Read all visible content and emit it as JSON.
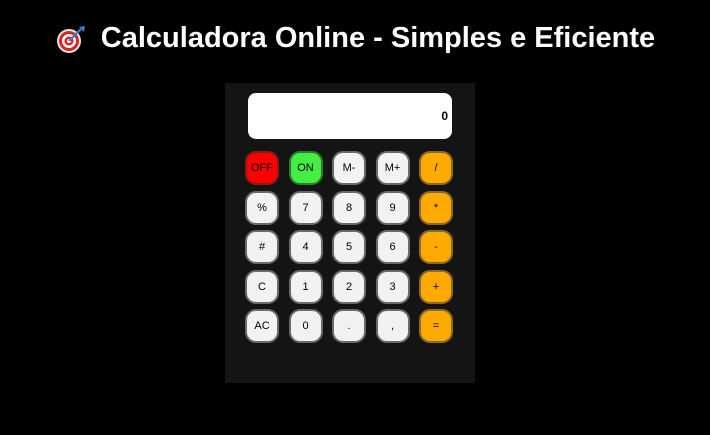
{
  "header": {
    "icon": "target-dart-icon",
    "title": "Calculadora Online - Simples e Eficiente"
  },
  "display": {
    "value": "0"
  },
  "keys": [
    {
      "label": "OFF",
      "name": "off-button",
      "kind": "off"
    },
    {
      "label": "ON",
      "name": "on-button",
      "kind": "on"
    },
    {
      "label": "M-",
      "name": "memory-minus-button",
      "kind": "num"
    },
    {
      "label": "M+",
      "name": "memory-plus-button",
      "kind": "num"
    },
    {
      "label": "/",
      "name": "divide-button",
      "kind": "op"
    },
    {
      "label": "%",
      "name": "percent-button",
      "kind": "num"
    },
    {
      "label": "7",
      "name": "digit-7-button",
      "kind": "num"
    },
    {
      "label": "8",
      "name": "digit-8-button",
      "kind": "num"
    },
    {
      "label": "9",
      "name": "digit-9-button",
      "kind": "num"
    },
    {
      "label": "*",
      "name": "multiply-button",
      "kind": "op"
    },
    {
      "label": "#",
      "name": "hash-button",
      "kind": "num"
    },
    {
      "label": "4",
      "name": "digit-4-button",
      "kind": "num"
    },
    {
      "label": "5",
      "name": "digit-5-button",
      "kind": "num"
    },
    {
      "label": "6",
      "name": "digit-6-button",
      "kind": "num"
    },
    {
      "label": "-",
      "name": "subtract-button",
      "kind": "op"
    },
    {
      "label": "C",
      "name": "clear-button",
      "kind": "num"
    },
    {
      "label": "1",
      "name": "digit-1-button",
      "kind": "num"
    },
    {
      "label": "2",
      "name": "digit-2-button",
      "kind": "num"
    },
    {
      "label": "3",
      "name": "digit-3-button",
      "kind": "num"
    },
    {
      "label": "+",
      "name": "add-button",
      "kind": "op"
    },
    {
      "label": "AC",
      "name": "all-clear-button",
      "kind": "num"
    },
    {
      "label": "0",
      "name": "digit-0-button",
      "kind": "num"
    },
    {
      "label": ".",
      "name": "decimal-point-button",
      "kind": "num"
    },
    {
      "label": ",",
      "name": "comma-button",
      "kind": "num"
    },
    {
      "label": "=",
      "name": "equals-button",
      "kind": "op"
    }
  ],
  "colors": {
    "background": "#000000",
    "panel": "#141414",
    "off": "#ff0000",
    "on": "#44ee44",
    "operator": "#ffaa00",
    "key": "#f2f2f2"
  }
}
